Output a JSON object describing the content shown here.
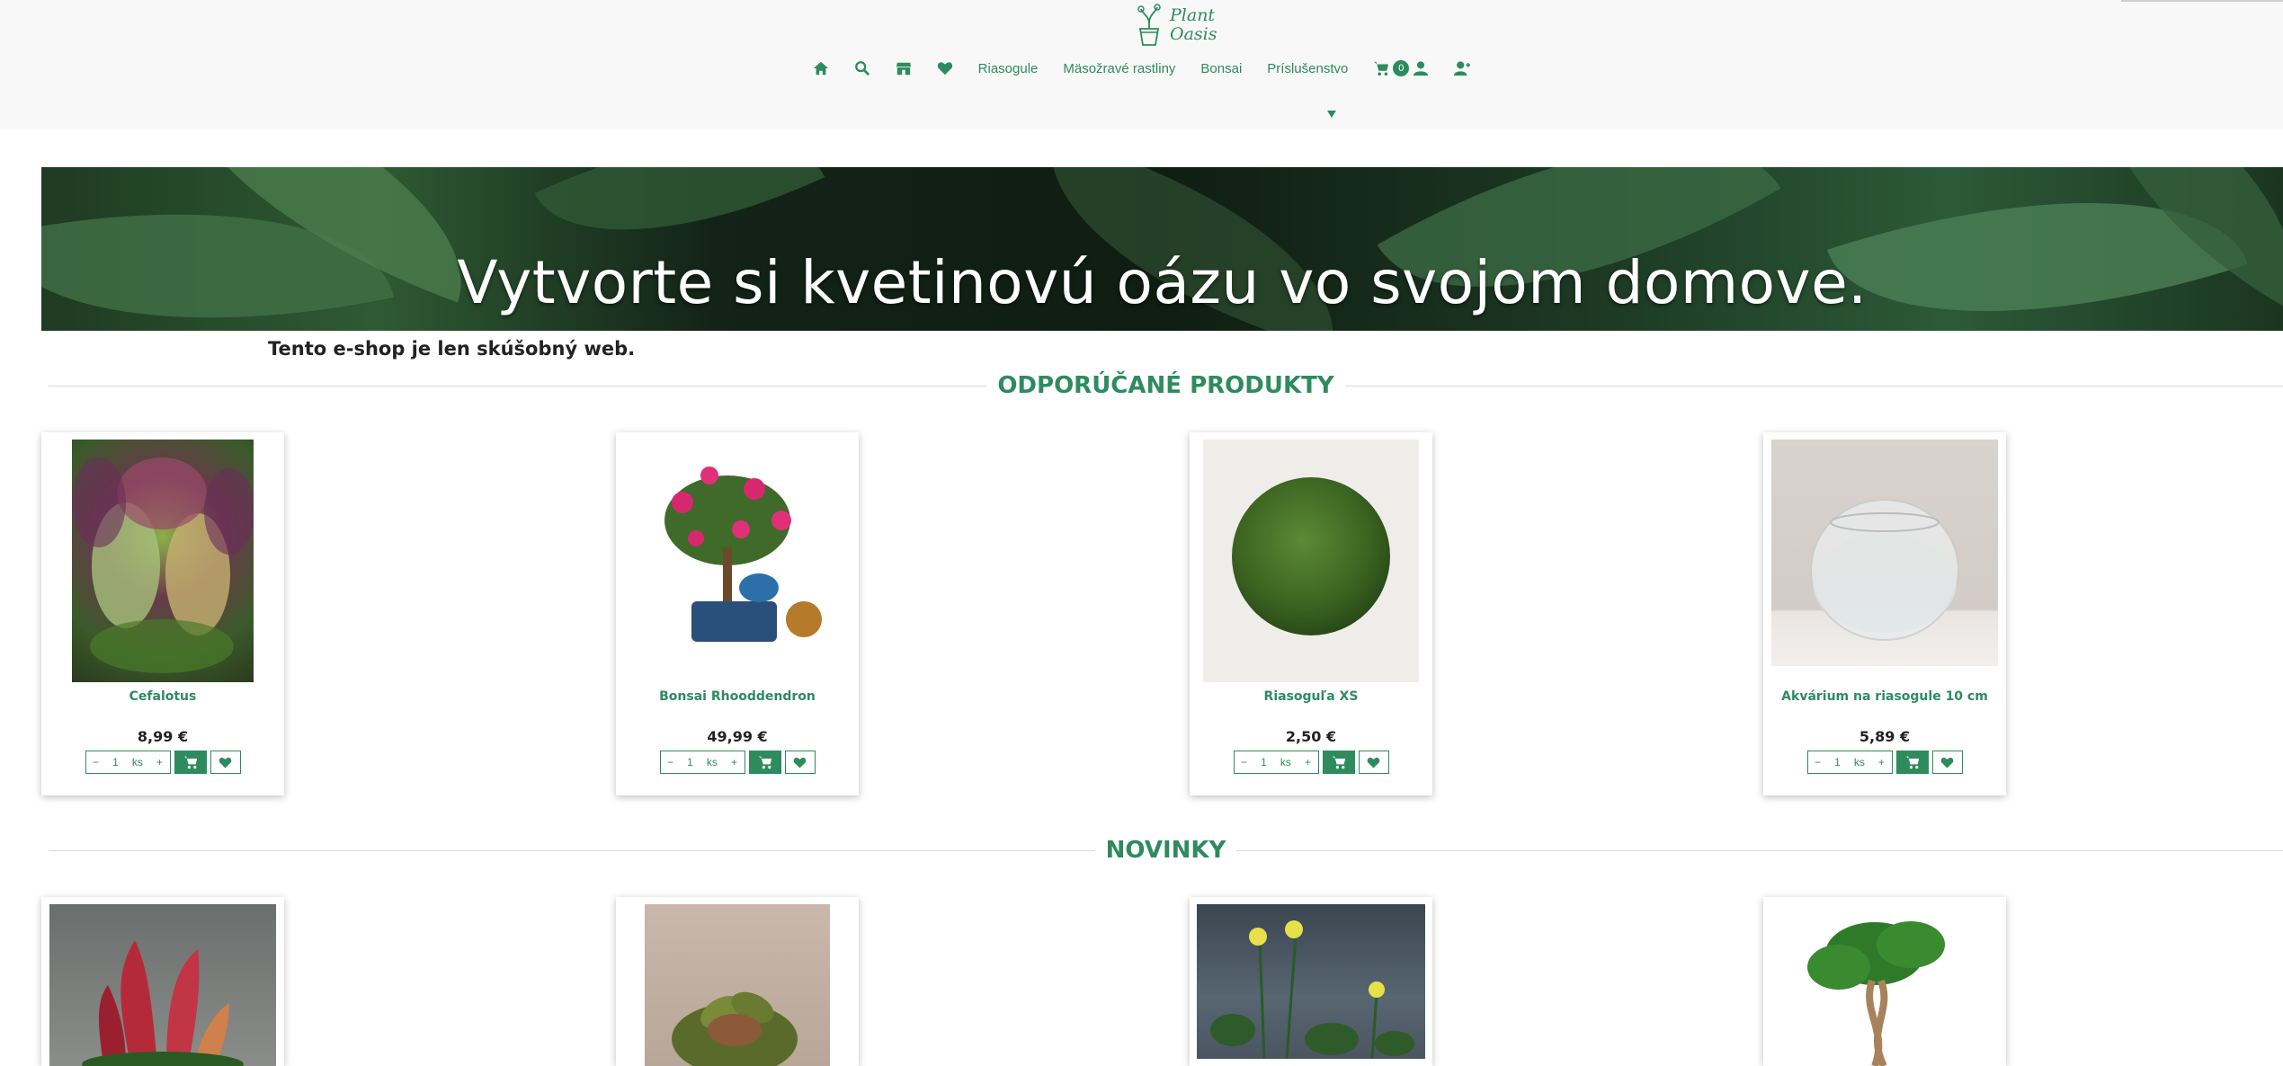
{
  "brand": {
    "logo_line1": "Plant",
    "logo_line2": "Oasis",
    "accent": "#2e8b5e"
  },
  "nav": {
    "home_icon": "home-icon",
    "search_icon": "search-icon",
    "store_icon": "store-icon",
    "favorites_icon": "heart-icon",
    "items": [
      "Riasogule",
      "Mäsožravé rastliny",
      "Bonsai",
      "Príslušenstvo"
    ],
    "cart_count": "0",
    "cart_icon": "cart-icon",
    "user_icon": "user-icon",
    "register_icon": "user-plus-icon"
  },
  "hero": {
    "title": "Vytvorte si kvetinovú oázu vo svojom domove."
  },
  "notice": "Tento e-shop je len skúšobný web.",
  "featured": {
    "title": "ODPORÚČANÉ PRODUKTY",
    "products": [
      {
        "name": "Cefalotus",
        "price": "8,99 €",
        "qty": "1",
        "unit": "ks"
      },
      {
        "name": "Bonsai Rhooddendron",
        "price": "49,99 €",
        "qty": "1",
        "unit": "ks"
      },
      {
        "name": "Riasoguľa XS",
        "price": "2,50 €",
        "qty": "1",
        "unit": "ks"
      },
      {
        "name": "Akvárium na riasogule 10 cm",
        "price": "5,89 €",
        "qty": "1",
        "unit": "ks"
      }
    ]
  },
  "news": {
    "title": "NOVINKY"
  },
  "controls": {
    "minus": "−",
    "plus": "+"
  }
}
